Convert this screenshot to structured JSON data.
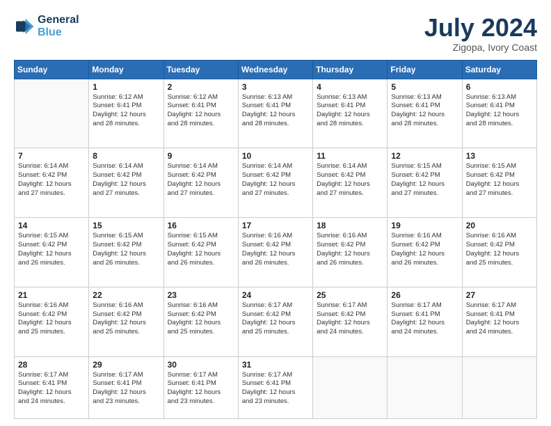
{
  "header": {
    "logo_line1": "General",
    "logo_line2": "Blue",
    "month": "July 2024",
    "location": "Zigopa, Ivory Coast"
  },
  "weekdays": [
    "Sunday",
    "Monday",
    "Tuesday",
    "Wednesday",
    "Thursday",
    "Friday",
    "Saturday"
  ],
  "weeks": [
    [
      {
        "day": "",
        "info": ""
      },
      {
        "day": "1",
        "info": "Sunrise: 6:12 AM\nSunset: 6:41 PM\nDaylight: 12 hours\nand 28 minutes."
      },
      {
        "day": "2",
        "info": "Sunrise: 6:12 AM\nSunset: 6:41 PM\nDaylight: 12 hours\nand 28 minutes."
      },
      {
        "day": "3",
        "info": "Sunrise: 6:13 AM\nSunset: 6:41 PM\nDaylight: 12 hours\nand 28 minutes."
      },
      {
        "day": "4",
        "info": "Sunrise: 6:13 AM\nSunset: 6:41 PM\nDaylight: 12 hours\nand 28 minutes."
      },
      {
        "day": "5",
        "info": "Sunrise: 6:13 AM\nSunset: 6:41 PM\nDaylight: 12 hours\nand 28 minutes."
      },
      {
        "day": "6",
        "info": "Sunrise: 6:13 AM\nSunset: 6:41 PM\nDaylight: 12 hours\nand 28 minutes."
      }
    ],
    [
      {
        "day": "7",
        "info": "Sunrise: 6:14 AM\nSunset: 6:42 PM\nDaylight: 12 hours\nand 27 minutes."
      },
      {
        "day": "8",
        "info": "Sunrise: 6:14 AM\nSunset: 6:42 PM\nDaylight: 12 hours\nand 27 minutes."
      },
      {
        "day": "9",
        "info": "Sunrise: 6:14 AM\nSunset: 6:42 PM\nDaylight: 12 hours\nand 27 minutes."
      },
      {
        "day": "10",
        "info": "Sunrise: 6:14 AM\nSunset: 6:42 PM\nDaylight: 12 hours\nand 27 minutes."
      },
      {
        "day": "11",
        "info": "Sunrise: 6:14 AM\nSunset: 6:42 PM\nDaylight: 12 hours\nand 27 minutes."
      },
      {
        "day": "12",
        "info": "Sunrise: 6:15 AM\nSunset: 6:42 PM\nDaylight: 12 hours\nand 27 minutes."
      },
      {
        "day": "13",
        "info": "Sunrise: 6:15 AM\nSunset: 6:42 PM\nDaylight: 12 hours\nand 27 minutes."
      }
    ],
    [
      {
        "day": "14",
        "info": "Sunrise: 6:15 AM\nSunset: 6:42 PM\nDaylight: 12 hours\nand 26 minutes."
      },
      {
        "day": "15",
        "info": "Sunrise: 6:15 AM\nSunset: 6:42 PM\nDaylight: 12 hours\nand 26 minutes."
      },
      {
        "day": "16",
        "info": "Sunrise: 6:15 AM\nSunset: 6:42 PM\nDaylight: 12 hours\nand 26 minutes."
      },
      {
        "day": "17",
        "info": "Sunrise: 6:16 AM\nSunset: 6:42 PM\nDaylight: 12 hours\nand 26 minutes."
      },
      {
        "day": "18",
        "info": "Sunrise: 6:16 AM\nSunset: 6:42 PM\nDaylight: 12 hours\nand 26 minutes."
      },
      {
        "day": "19",
        "info": "Sunrise: 6:16 AM\nSunset: 6:42 PM\nDaylight: 12 hours\nand 26 minutes."
      },
      {
        "day": "20",
        "info": "Sunrise: 6:16 AM\nSunset: 6:42 PM\nDaylight: 12 hours\nand 25 minutes."
      }
    ],
    [
      {
        "day": "21",
        "info": "Sunrise: 6:16 AM\nSunset: 6:42 PM\nDaylight: 12 hours\nand 25 minutes."
      },
      {
        "day": "22",
        "info": "Sunrise: 6:16 AM\nSunset: 6:42 PM\nDaylight: 12 hours\nand 25 minutes."
      },
      {
        "day": "23",
        "info": "Sunrise: 6:16 AM\nSunset: 6:42 PM\nDaylight: 12 hours\nand 25 minutes."
      },
      {
        "day": "24",
        "info": "Sunrise: 6:17 AM\nSunset: 6:42 PM\nDaylight: 12 hours\nand 25 minutes."
      },
      {
        "day": "25",
        "info": "Sunrise: 6:17 AM\nSunset: 6:42 PM\nDaylight: 12 hours\nand 24 minutes."
      },
      {
        "day": "26",
        "info": "Sunrise: 6:17 AM\nSunset: 6:41 PM\nDaylight: 12 hours\nand 24 minutes."
      },
      {
        "day": "27",
        "info": "Sunrise: 6:17 AM\nSunset: 6:41 PM\nDaylight: 12 hours\nand 24 minutes."
      }
    ],
    [
      {
        "day": "28",
        "info": "Sunrise: 6:17 AM\nSunset: 6:41 PM\nDaylight: 12 hours\nand 24 minutes."
      },
      {
        "day": "29",
        "info": "Sunrise: 6:17 AM\nSunset: 6:41 PM\nDaylight: 12 hours\nand 23 minutes."
      },
      {
        "day": "30",
        "info": "Sunrise: 6:17 AM\nSunset: 6:41 PM\nDaylight: 12 hours\nand 23 minutes."
      },
      {
        "day": "31",
        "info": "Sunrise: 6:17 AM\nSunset: 6:41 PM\nDaylight: 12 hours\nand 23 minutes."
      },
      {
        "day": "",
        "info": ""
      },
      {
        "day": "",
        "info": ""
      },
      {
        "day": "",
        "info": ""
      }
    ]
  ]
}
